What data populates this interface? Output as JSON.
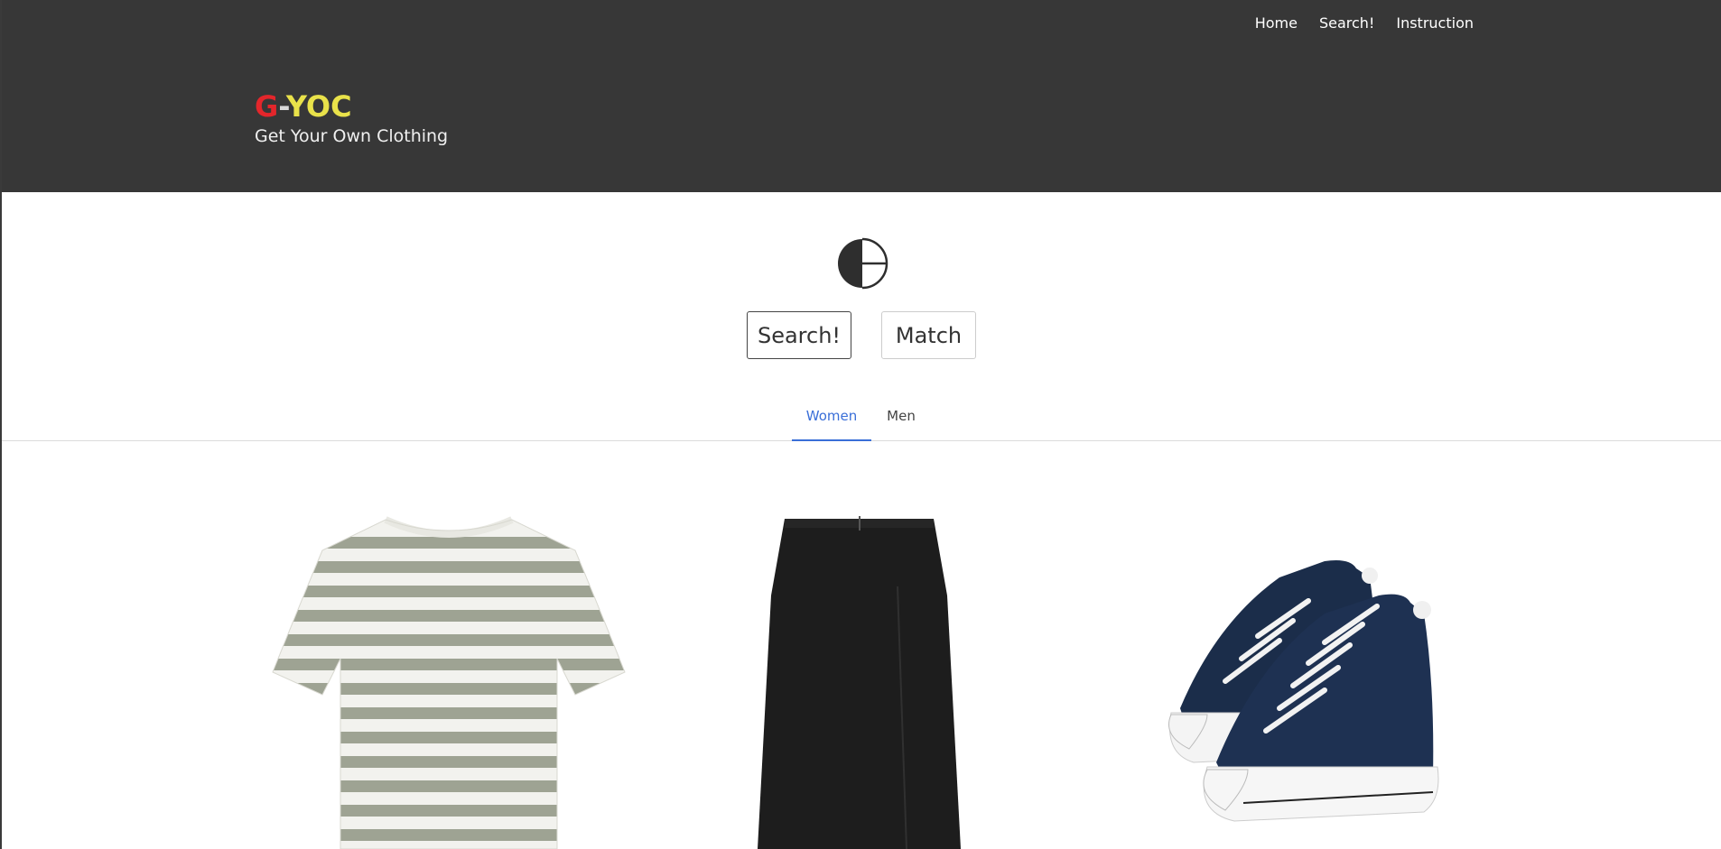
{
  "header": {
    "nav": [
      "Home",
      "Search!",
      "Instruction"
    ],
    "brand_g": "G",
    "brand_dash": "-",
    "brand_yoc": "YOC",
    "tagline": "Get Your Own Clothing"
  },
  "actions": {
    "search_label": "Search!",
    "match_label": "Match"
  },
  "tabs": [
    {
      "label": "Women",
      "active": true
    },
    {
      "label": "Men",
      "active": false
    }
  ],
  "products": [
    {
      "icon": "striped-tshirt-image"
    },
    {
      "icon": "black-skirt-image"
    },
    {
      "icon": "navy-sneakers-image"
    }
  ],
  "colors": {
    "header_bg": "#373737",
    "brand_g": "#e3262b",
    "brand_yoc": "#e9e24a",
    "tab_active": "#3a6fd8"
  }
}
